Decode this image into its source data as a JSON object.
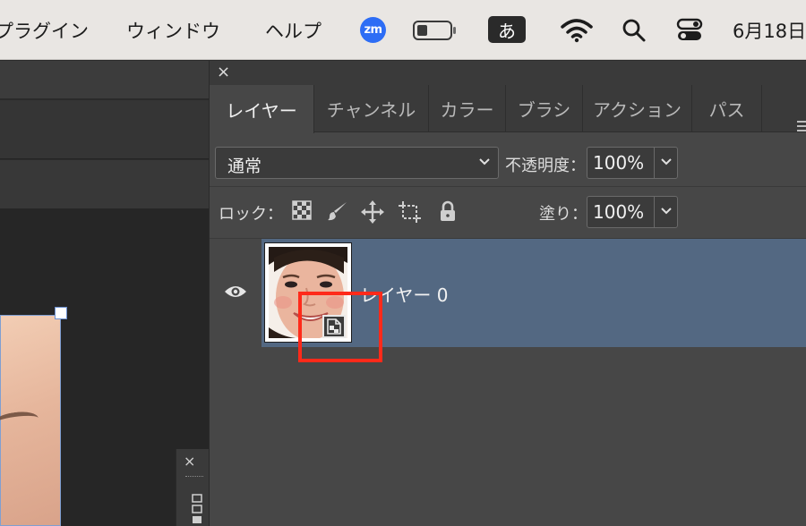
{
  "menubar": {
    "items": [
      "プラグイン",
      "ウィンドウ",
      "ヘルプ"
    ],
    "zoom_badge": "zm",
    "ime_label": "あ",
    "clock": "6月18日"
  },
  "panel": {
    "close_glyph": "×",
    "tabs": [
      {
        "label": "レイヤー",
        "active": true
      },
      {
        "label": "チャンネル"
      },
      {
        "label": "カラー"
      },
      {
        "label": "ブラシ"
      },
      {
        "label": "アクション"
      },
      {
        "label": "パス"
      }
    ],
    "blend_mode": "通常",
    "opacity_label": "不透明度：",
    "opacity_value": "100%",
    "lock_label": "ロック：",
    "fill_label": "塗り：",
    "fill_value": "100%",
    "layers": [
      {
        "name": "レイヤー 0",
        "selected": true,
        "smart_object": true,
        "visible": true
      }
    ]
  },
  "mini_panel": {
    "close_glyph": "×"
  },
  "colors": {
    "selection": "#536882",
    "highlight_box": "#ff2a1a",
    "zoom_blue": "#2d6df5"
  },
  "icons": [
    "battery-icon",
    "wifi-icon",
    "search-icon",
    "control-center-icon",
    "eye-icon",
    "lock-transparent-icon",
    "lock-brush-icon",
    "lock-move-icon",
    "lock-artboard-icon",
    "lock-all-icon",
    "smart-object-icon",
    "chevron-down-icon",
    "panel-menu-icon"
  ]
}
